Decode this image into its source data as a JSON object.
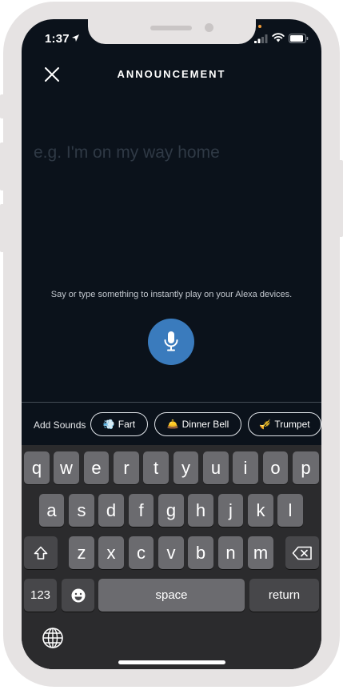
{
  "status_bar": {
    "time": "1:37"
  },
  "header": {
    "title": "ANNOUNCEMENT"
  },
  "message": {
    "placeholder": "e.g. I'm on my way home",
    "value": ""
  },
  "hint_text": "Say or type something to instantly play on your Alexa devices.",
  "sounds": {
    "label": "Add Sounds",
    "items": [
      {
        "emoji": "💨",
        "label": "Fart"
      },
      {
        "emoji": "🛎️",
        "label": "Dinner Bell"
      },
      {
        "emoji": "🎺",
        "label": "Trumpet"
      }
    ]
  },
  "keyboard": {
    "row1": [
      "q",
      "w",
      "e",
      "r",
      "t",
      "y",
      "u",
      "i",
      "o",
      "p"
    ],
    "row2": [
      "a",
      "s",
      "d",
      "f",
      "g",
      "h",
      "j",
      "k",
      "l"
    ],
    "row3": [
      "z",
      "x",
      "c",
      "v",
      "b",
      "n",
      "m"
    ],
    "numbers_label": "123",
    "space_label": "space",
    "return_label": "return"
  },
  "colors": {
    "background": "#0b121b",
    "mic": "#3a7bbd",
    "device": "#e6e3e3"
  }
}
